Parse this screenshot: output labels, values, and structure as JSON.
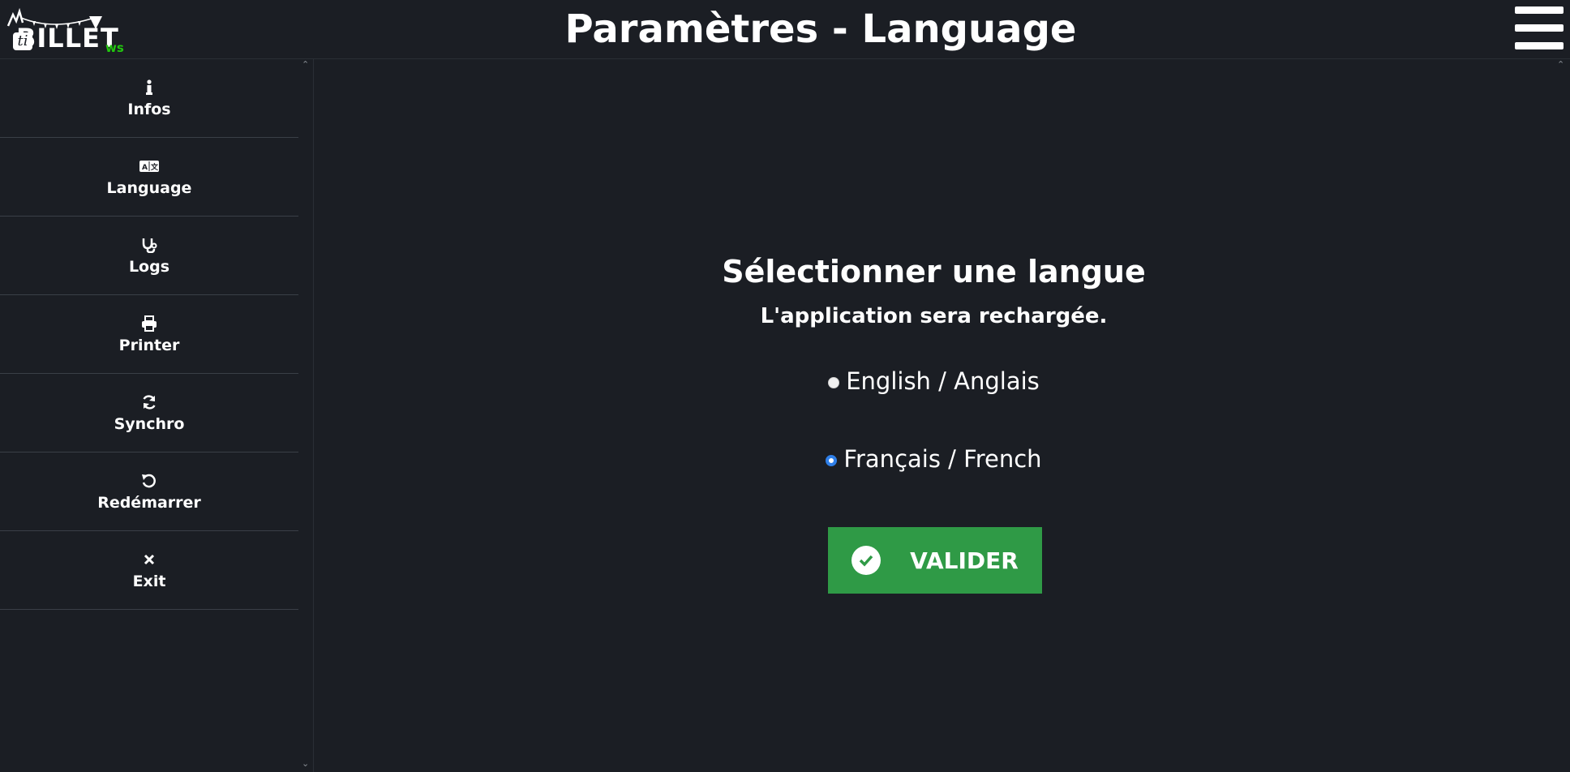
{
  "header": {
    "logo_text": "BILLET",
    "logo_ti": "ti",
    "logo_ws": "ws",
    "title": "Paramètres - Language",
    "menu_icon": "hamburger-menu-icon"
  },
  "sidebar": {
    "items": [
      {
        "icon": "info-icon",
        "label": "Infos"
      },
      {
        "icon": "language-icon",
        "label": "Language"
      },
      {
        "icon": "stethoscope-icon",
        "label": "Logs"
      },
      {
        "icon": "printer-icon",
        "label": "Printer"
      },
      {
        "icon": "sync-icon",
        "label": "Synchro"
      },
      {
        "icon": "restart-icon",
        "label": "Redémarrer"
      },
      {
        "icon": "close-icon",
        "label": "Exit"
      }
    ]
  },
  "main": {
    "title": "Sélectionner une langue",
    "subtitle": "L'application sera rechargée.",
    "options": [
      {
        "label": "English / Anglais",
        "selected": false
      },
      {
        "label": "Français / French",
        "selected": true
      }
    ],
    "validate_label": "VALIDER"
  },
  "colors": {
    "background": "#1b1e24",
    "validate_button": "#2f9a46",
    "radio_selected": "#2f7fe8",
    "logo_ws": "#22c50f"
  }
}
